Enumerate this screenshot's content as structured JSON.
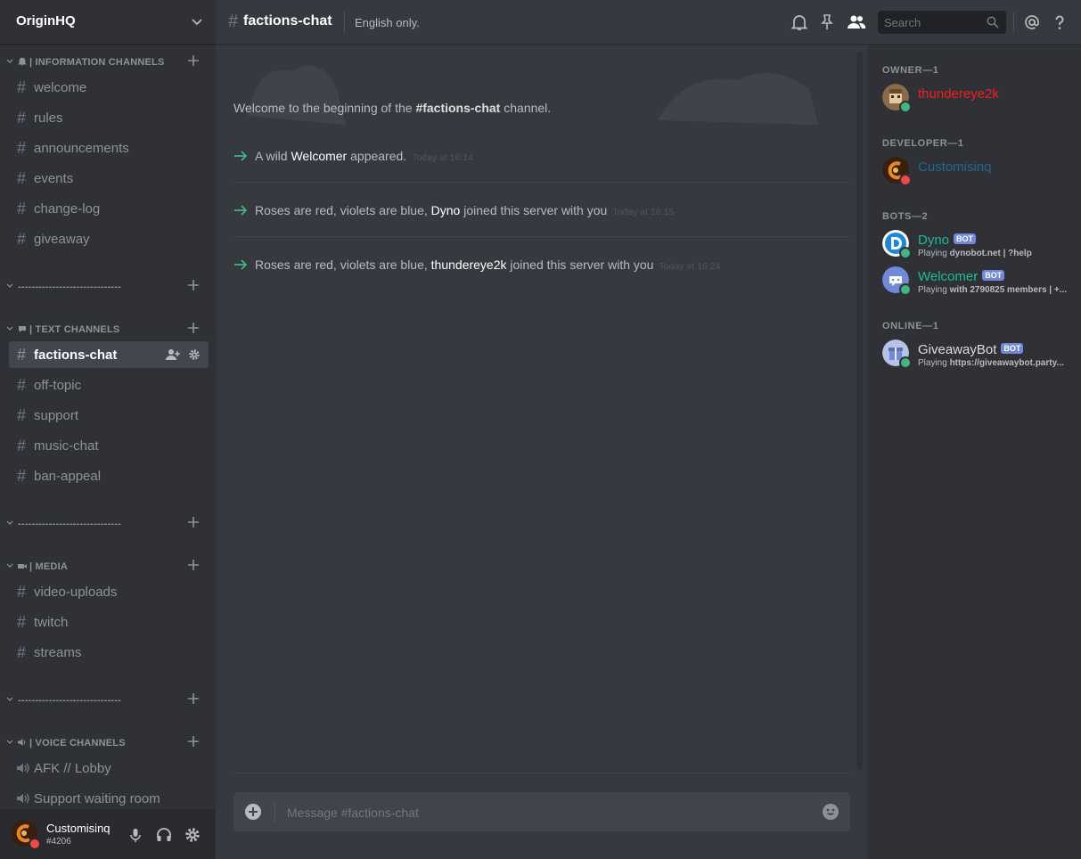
{
  "server": {
    "name": "OriginHQ"
  },
  "categories": [
    {
      "label": "| INFORMATION CHANNELS",
      "icon": "bell-icon"
    },
    {
      "label": "------------------------------",
      "icon": ""
    },
    {
      "label": "| TEXT CHANNELS",
      "icon": "speech-bubble-icon"
    },
    {
      "label": "------------------------------",
      "icon": ""
    },
    {
      "label": "| MEDIA",
      "icon": "camera-icon"
    },
    {
      "label": "------------------------------",
      "icon": ""
    },
    {
      "label": "| VOICE CHANNELS",
      "icon": "speaker-icon"
    }
  ],
  "channels": {
    "info": [
      "welcome",
      "rules",
      "announcements",
      "events",
      "change-log",
      "giveaway"
    ],
    "text": [
      "factions-chat",
      "off-topic",
      "support",
      "music-chat",
      "ban-appeal"
    ],
    "media": [
      "video-uploads",
      "twitch",
      "streams"
    ],
    "voice": [
      "AFK // Lobby",
      "Support waiting room"
    ]
  },
  "active_channel": "factions-chat",
  "user": {
    "name": "Customisinq",
    "tag": "#4206",
    "status": "dnd"
  },
  "header": {
    "hash": "#",
    "title": "factions-chat",
    "topic": "English only."
  },
  "search": {
    "placeholder": "Search"
  },
  "welcome": {
    "prefix": "Welcome to the beginning of the ",
    "channel": "#factions-chat",
    "suffix": " channel."
  },
  "messages": [
    {
      "pre": "A wild ",
      "who": "Welcomer",
      "post": " appeared.",
      "ts": "Today at 16:14"
    },
    {
      "pre": "Roses are red, violets are blue, ",
      "who": "Dyno",
      "post": " joined this server with you",
      "ts": "Today at 16:15"
    },
    {
      "pre": "Roses are red, violets are blue, ",
      "who": "thundereye2k",
      "post": " joined this server with you",
      "ts": "Today at 16:24"
    }
  ],
  "composer": {
    "placeholder": "Message #factions-chat"
  },
  "member_groups": [
    {
      "heading": "OWNER—1"
    },
    {
      "heading": "DEVELOPER—1"
    },
    {
      "heading": "BOTS—2"
    },
    {
      "heading": "ONLINE—1"
    }
  ],
  "members": [
    {
      "name": "thundereye2k",
      "color": "#f41d1d",
      "status": "online",
      "bot": false,
      "activity_prefix": "",
      "activity": ""
    },
    {
      "name": "Customisinq",
      "color": "#206694",
      "status": "dnd",
      "bot": false,
      "activity_prefix": "",
      "activity": ""
    },
    {
      "name": "Dyno",
      "color": "#1abc9c",
      "status": "online",
      "bot": true,
      "bot_label": "BOT",
      "activity_prefix": "Playing ",
      "activity": "dynobot.net | ?help"
    },
    {
      "name": "Welcomer",
      "color": "#1abc9c",
      "status": "online",
      "bot": true,
      "bot_label": "BOT",
      "activity_prefix": "Playing ",
      "activity": "with 2790825 members | +..."
    },
    {
      "name": "GiveawayBot",
      "color": "#dcddde",
      "status": "online",
      "bot": true,
      "bot_label": "BOT",
      "activity_prefix": "Playing ",
      "activity": "https://giveawaybot.party..."
    }
  ],
  "colors": {
    "online": "#43b581",
    "dnd": "#f04747",
    "accent": "#7289da",
    "system_arrow": "#43b581"
  }
}
